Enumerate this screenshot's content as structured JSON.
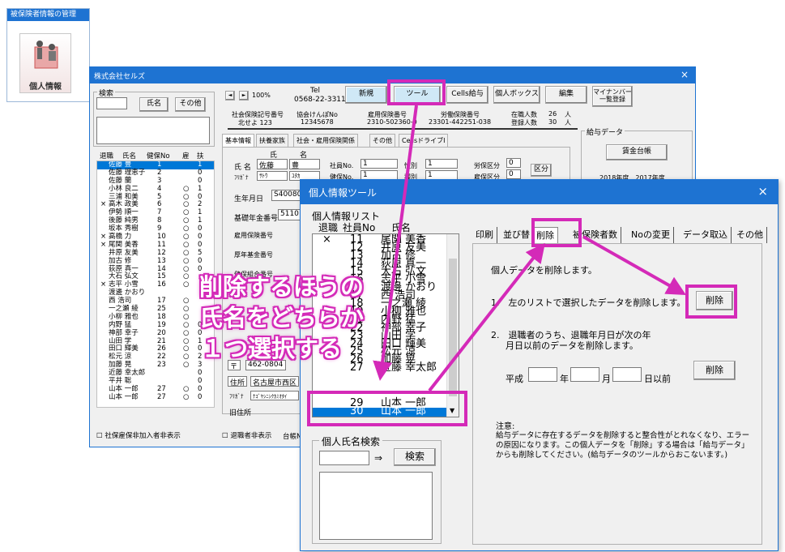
{
  "launcher": {
    "header": "被保険者情報の管理",
    "icon_label": "個人情報"
  },
  "main": {
    "title": "株式会社セルズ",
    "close": "×",
    "search": {
      "legend": "検索",
      "name_btn": "氏名",
      "other_btn": "その他"
    },
    "nav": {
      "prev": "◄",
      "next": "►",
      "zoom": "100%"
    },
    "tel": {
      "label": "Tel",
      "value": "0568-22-3311"
    },
    "buttons": {
      "new": "新規",
      "tool": "ツール",
      "cells": "Cells給与",
      "box": "個人ボックス",
      "edit": "編集",
      "mynumber": "マイナンバー 一覧登録"
    },
    "info": {
      "shaho_label": "社会保険記号番号",
      "shaho_val": "北せよ 123",
      "kyokai_label": "協会けんぽNo",
      "kyokai_val": "12345678",
      "koyo_label": "雇用保険番号",
      "koyo_val": "2310-502360-0",
      "rodo_label": "労働保険番号",
      "rodo_val": "23301-442251-038",
      "zaishoku_label": "在職人数",
      "zaishoku_val": "26",
      "touroku_label": "登録人数",
      "touroku_val": "30",
      "unit": "人"
    },
    "list_header": {
      "c1": "退職",
      "c2": "氏名",
      "c3": "健保No",
      "c4": "雇",
      "c5": "扶"
    },
    "list": [
      {
        "r": "",
        "n": "佐藤 豊",
        "k": "1",
        "y": "",
        "f": "1"
      },
      {
        "r": "",
        "n": "佐藤 理恵子",
        "k": "2",
        "y": "",
        "f": "0"
      },
      {
        "r": "",
        "n": "佐藤 蘭",
        "k": "3",
        "y": "",
        "f": "0"
      },
      {
        "r": "",
        "n": "小林 良二",
        "k": "4",
        "y": "○",
        "f": "1"
      },
      {
        "r": "",
        "n": "三浦 和美",
        "k": "5",
        "y": "○",
        "f": "0"
      },
      {
        "r": "×",
        "n": "高木 政美",
        "k": "6",
        "y": "○",
        "f": "2"
      },
      {
        "r": "",
        "n": "伊勢 順一",
        "k": "7",
        "y": "○",
        "f": "1"
      },
      {
        "r": "",
        "n": "後藤 純男",
        "k": "8",
        "y": "○",
        "f": "1"
      },
      {
        "r": "",
        "n": "坂本 秀樹",
        "k": "9",
        "y": "○",
        "f": "0"
      },
      {
        "r": "×",
        "n": "高橋 力",
        "k": "10",
        "y": "○",
        "f": "0"
      },
      {
        "r": "×",
        "n": "尾関 美香",
        "k": "11",
        "y": "○",
        "f": "0"
      },
      {
        "r": "",
        "n": "井原 友美",
        "k": "12",
        "y": "○",
        "f": "5"
      },
      {
        "r": "",
        "n": "加古 修",
        "k": "13",
        "y": "○",
        "f": "0"
      },
      {
        "r": "",
        "n": "荻原 真一",
        "k": "14",
        "y": "○",
        "f": "0"
      },
      {
        "r": "",
        "n": "大石 弘文",
        "k": "15",
        "y": "○",
        "f": ""
      },
      {
        "r": "×",
        "n": "志平 小雪",
        "k": "16",
        "y": "○",
        "f": ""
      },
      {
        "r": "",
        "n": "渡邊 かおり",
        "k": "",
        "y": "",
        "f": ""
      },
      {
        "r": "",
        "n": "西 浩司",
        "k": "17",
        "y": "○",
        "f": ""
      },
      {
        "r": "",
        "n": "一之瀬 綾",
        "k": "25",
        "y": "○",
        "f": ""
      },
      {
        "r": "",
        "n": "小柳 雅也",
        "k": "18",
        "y": "○",
        "f": ""
      },
      {
        "r": "",
        "n": "内野 猛",
        "k": "19",
        "y": "○",
        "f": "0"
      },
      {
        "r": "",
        "n": "神部 幸子",
        "k": "20",
        "y": "○",
        "f": "0"
      },
      {
        "r": "",
        "n": "山田 学",
        "k": "21",
        "y": "○",
        "f": "1"
      },
      {
        "r": "",
        "n": "田口 輝美",
        "k": "26",
        "y": "○",
        "f": "0"
      },
      {
        "r": "",
        "n": "松元 涼",
        "k": "22",
        "y": "○",
        "f": "2"
      },
      {
        "r": "",
        "n": "加藤 晃",
        "k": "23",
        "y": "○",
        "f": "3"
      },
      {
        "r": "",
        "n": "近藤 幸太郎",
        "k": "",
        "y": "",
        "f": "0"
      },
      {
        "r": "",
        "n": "平井 聡",
        "k": "",
        "y": "",
        "f": "0"
      },
      {
        "r": "",
        "n": "山本 一郎",
        "k": "27",
        "y": "○",
        "f": "0"
      },
      {
        "r": "",
        "n": "山本 一郎",
        "k": "27",
        "y": "○",
        "f": "0"
      }
    ],
    "check_shaho": "社保雇保非加入者非表示",
    "check_retired": "退職者非表示",
    "daicho": "台帳No",
    "tabs": [
      "基本情報",
      "扶養家族",
      "社会・雇用保険関係",
      "その他",
      "CellsドライブI"
    ],
    "form": {
      "shi": "氏",
      "mei": "名",
      "name_label": "氏 名",
      "sei_val": "佐藤",
      "mei_val": "豊",
      "kana_label": "ﾌﾘｶﾞﾅ",
      "sei_kana": "ｻﾄｳ",
      "mei_kana": "ﾕﾀｶ",
      "shain_label": "社員No.",
      "shain_val": "1",
      "sex_label": "性別",
      "sex_val": "1",
      "shubetsu_label": "種別",
      "shubetsu_val": "1",
      "kenpo_label": "健保No.",
      "kenpo_val": "1",
      "rodo_label": "労保区分",
      "rodo_val": "0",
      "koyo_label": "雇保区分",
      "koyo_val": "0",
      "kubun_btn": "区分",
      "birth_label": "生年月日",
      "birth_val": "S400801",
      "kiso_label": "基礎年金番号",
      "kiso_val": "5110",
      "koyohoken_label": "雇用保険番号",
      "kosei_label": "厚年基金番号",
      "kenko_label": "健保組合番号",
      "zip_mark": "〒",
      "zip_val": "462-0804",
      "addr_label": "住所",
      "addr_val": "名古屋市西区",
      "addr_kana_label": "ﾌﾘｶﾞﾅ",
      "addr_kana_val": "ﾅｺﾞﾔｼﾆｼｸｶﾐｵﾀｲ",
      "old_label": "旧住所"
    },
    "kyuyo": {
      "legend": "給与データ",
      "btn": "賃金台帳",
      "years": "2018年度　2017年度"
    }
  },
  "dialog": {
    "title": "個人情報ツール",
    "close": "×",
    "list_label": "個人情報リスト",
    "list_header": {
      "c1": "退職",
      "c2": "社員No",
      "c3": "氏名"
    },
    "list": [
      {
        "r": "×",
        "no": "11",
        "n": "尾関 美香"
      },
      {
        "r": "",
        "no": "12",
        "n": "井原 友美"
      },
      {
        "r": "",
        "no": "13",
        "n": "加古 修"
      },
      {
        "r": "",
        "no": "14",
        "n": "荻原 真一"
      },
      {
        "r": "",
        "no": "15",
        "n": "大石 弘文"
      },
      {
        "r": "",
        "no": "16",
        "n": "志平 小雪"
      },
      {
        "r": "",
        "no": "",
        "n": "渡邊 かおり"
      },
      {
        "r": "",
        "no": "17",
        "n": "西 浩司"
      },
      {
        "r": "",
        "no": "18",
        "n": "一之瀬 綾"
      },
      {
        "r": "",
        "no": "19",
        "n": "小柳 雅也"
      },
      {
        "r": "",
        "no": "21",
        "n": "内野 猛"
      },
      {
        "r": "",
        "no": "22",
        "n": "神部 幸子"
      },
      {
        "r": "",
        "no": "23",
        "n": "山田 学"
      },
      {
        "r": "",
        "no": "24",
        "n": "田口 輝美"
      },
      {
        "r": "",
        "no": "25",
        "n": "松元 涼"
      },
      {
        "r": "",
        "no": "26",
        "n": "加藤 晃"
      },
      {
        "r": "",
        "no": "27",
        "n": "近藤 幸太郎"
      }
    ],
    "row29": {
      "no": "29",
      "n": "山本 一郎"
    },
    "row30": {
      "no": "30",
      "n": "山本 一郎"
    },
    "search": {
      "legend": "個人氏名検索",
      "arrow": "⇒",
      "btn": "検索"
    },
    "tabs": [
      "印刷",
      "並び替",
      "削除",
      "被保険者数",
      "Noの変更",
      "データ取込",
      "その他"
    ],
    "intro": "個人データを削除します。",
    "opt1": "1.　左のリストで選択したデータを削除します。",
    "btn_delete": "削除",
    "opt2_line1": "2.　退職者のうち、退職年月日が次の年",
    "opt2_line2": "月日以前のデータを削除します。",
    "heisei": "平成",
    "nen": "年",
    "gatsu": "月",
    "hi": "日以前",
    "btn_delete2": "削除",
    "note1": "注意:",
    "note2": "給与データに存在するデータを削除すると整合性がとれなくなり、エラー",
    "note3": "の原因になります。この個人データを「削除」する場合は「給与データ」",
    "note4": "からも削除してください。(給与データのツールからおこないます。)"
  },
  "callout": {
    "line1": "削除するほうの",
    "line2": "氏名をどちらか",
    "line3": "１つ選択する"
  },
  "colors": {
    "accent": "#d42ab8",
    "selection": "#0078d7",
    "title_blue": "#1e73d2"
  }
}
